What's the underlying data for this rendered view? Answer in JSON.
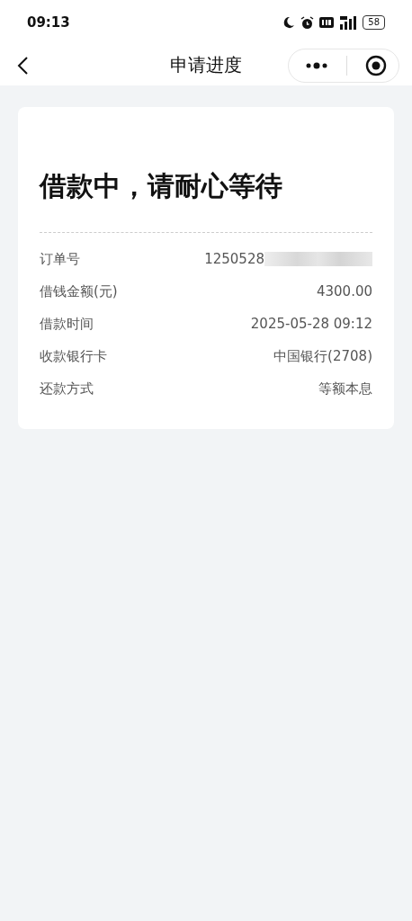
{
  "status_bar": {
    "time": "09:13",
    "battery": "58"
  },
  "nav_bar": {
    "title": "申请进度"
  },
  "card": {
    "heading": "借款中，请耐心等待",
    "rows": [
      {
        "label": "订单号",
        "value": "1250528",
        "redacted": true
      },
      {
        "label": "借钱金额(元)",
        "value": "4300.00",
        "redacted": false
      },
      {
        "label": "借款时间",
        "value": "2025-05-28 09:12",
        "redacted": false
      },
      {
        "label": "收款银行卡",
        "value": "中国银行(2708)",
        "redacted": false
      },
      {
        "label": "还款方式",
        "value": "等额本息",
        "redacted": false
      }
    ]
  }
}
